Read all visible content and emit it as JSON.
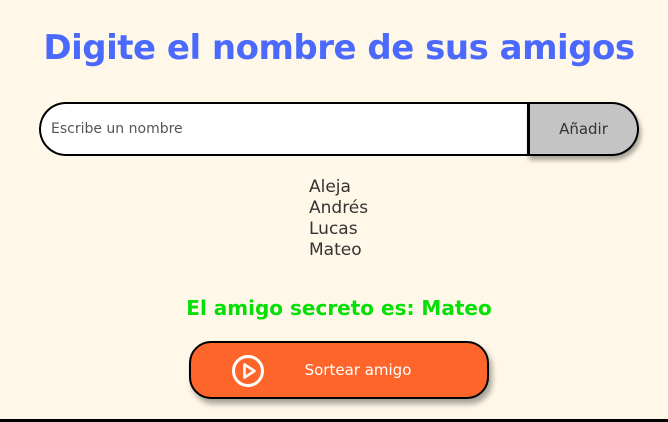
{
  "header": {
    "title": "Digite el nombre de sus amigos"
  },
  "form": {
    "input_placeholder": "Escribe un nombre",
    "input_value": "",
    "add_label": "Añadir"
  },
  "friends": [
    "Aleja",
    "Andrés",
    "Lucas",
    "Mateo"
  ],
  "result": {
    "text": "El amigo secreto es: Mateo"
  },
  "draw": {
    "label": "Sortear amigo",
    "icon": "play-circle-icon"
  },
  "colors": {
    "background": "#fff8e8",
    "title": "#4b69fd",
    "result": "#05df05",
    "draw_button": "#fe652b",
    "add_button": "#c4c4c4"
  }
}
